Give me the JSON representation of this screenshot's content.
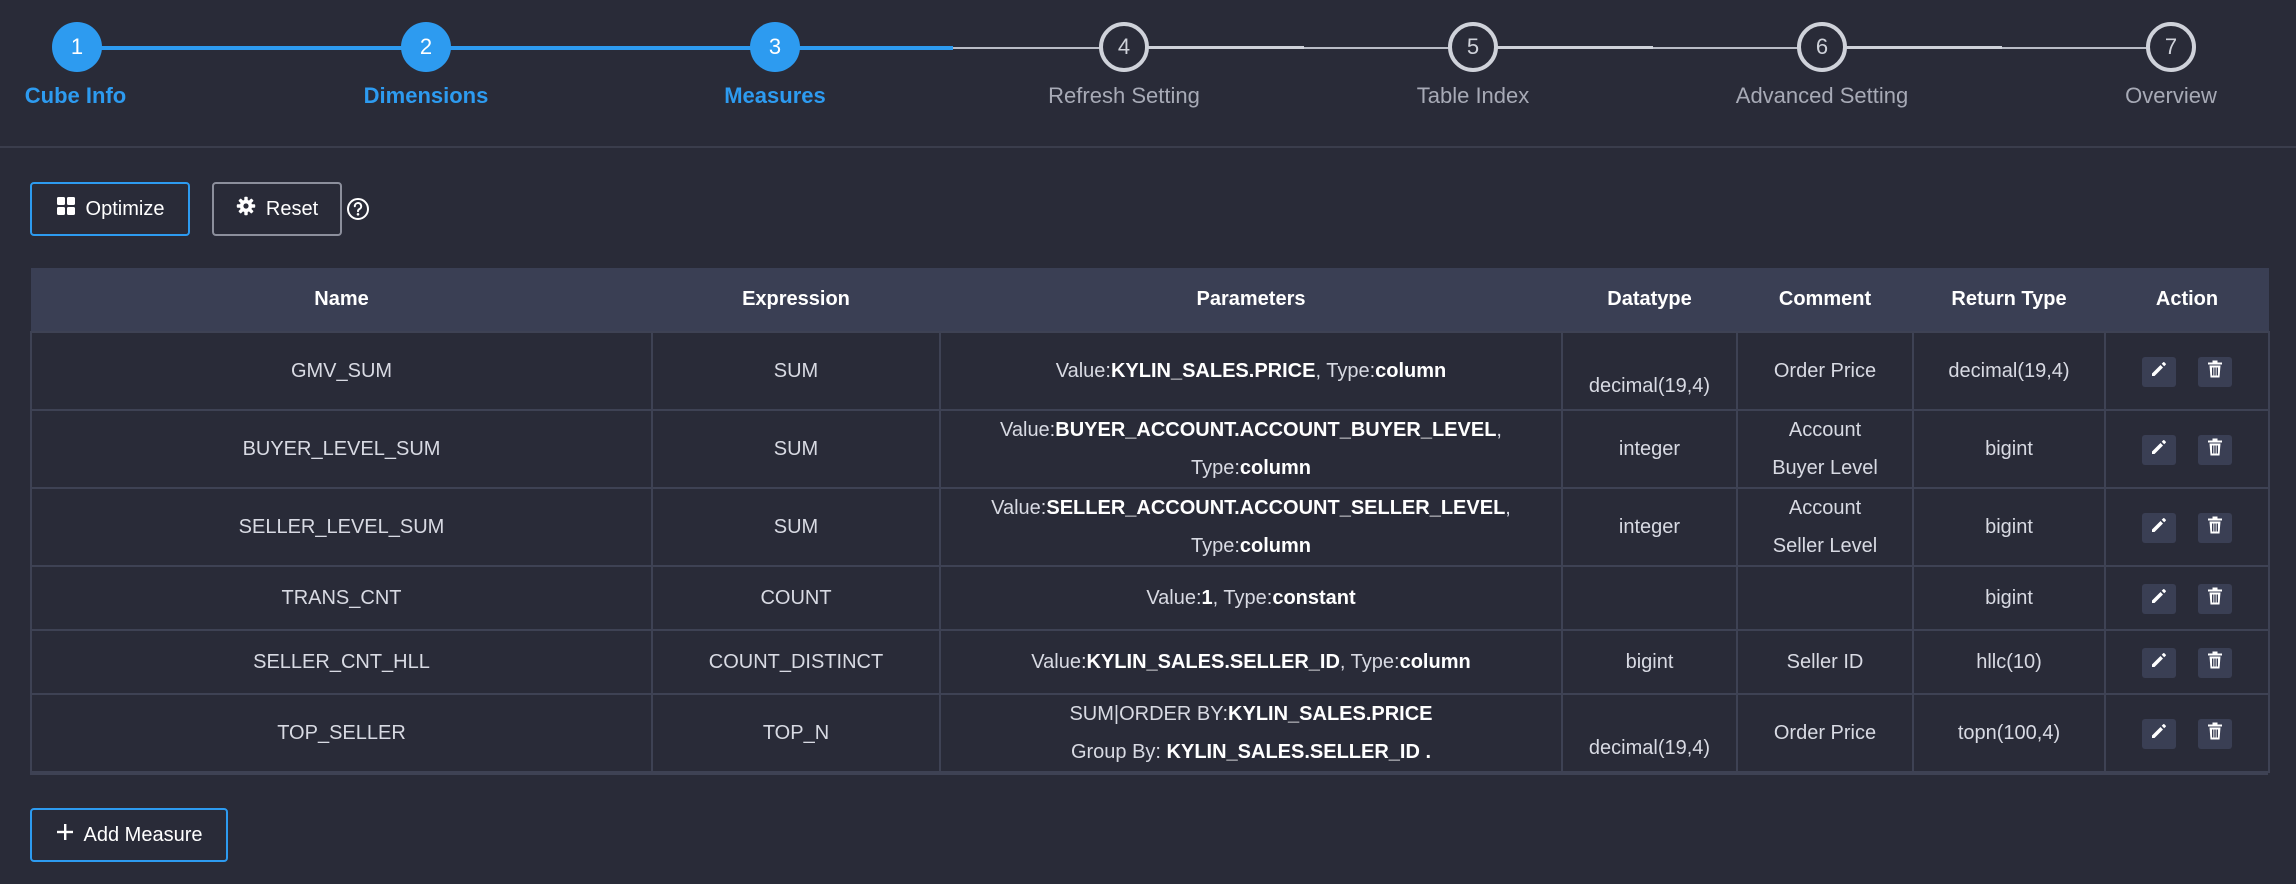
{
  "stepper": {
    "steps": [
      {
        "number": "1",
        "label": "Cube Info",
        "state": "done"
      },
      {
        "number": "2",
        "label": "Dimensions",
        "state": "done"
      },
      {
        "number": "3",
        "label": "Measures",
        "state": "done"
      },
      {
        "number": "4",
        "label": "Refresh Setting",
        "state": "todo"
      },
      {
        "number": "5",
        "label": "Table Index",
        "state": "todo"
      },
      {
        "number": "6",
        "label": "Advanced Setting",
        "state": "todo"
      },
      {
        "number": "7",
        "label": "Overview",
        "state": "todo"
      }
    ]
  },
  "toolbar": {
    "optimize_label": "Optimize",
    "reset_label": "Reset",
    "help_icon": "question-circle-icon"
  },
  "table": {
    "headers": [
      "Name",
      "Expression",
      "Parameters",
      "Datatype",
      "Comment",
      "Return Type",
      "Action"
    ],
    "rows": [
      {
        "name": "GMV_SUM",
        "expression": "SUM",
        "param_value_prefix": "Value:",
        "param_value": "KYLIN_SALES.PRICE",
        "param_type_prefix": ", Type:",
        "param_type": "column",
        "datatype": "decimal(19,4)",
        "comment": "Order Price",
        "return_type": "decimal(19,4)"
      },
      {
        "name": "BUYER_LEVEL_SUM",
        "expression": "SUM",
        "param_value_prefix": "Value:",
        "param_value": "BUYER_ACCOUNT.ACCOUNT_BUYER_LEVEL",
        "param_type_prefix": "Type:",
        "param_type": "column",
        "datatype": "integer",
        "comment_line1": "Account",
        "comment_line2": "Buyer Level",
        "return_type": "bigint"
      },
      {
        "name": "SELLER_LEVEL_SUM",
        "expression": "SUM",
        "param_value_prefix": "Value:",
        "param_value": "SELLER_ACCOUNT.ACCOUNT_SELLER_LEVEL",
        "param_type_prefix": "Type:",
        "param_type": "column",
        "datatype": "integer",
        "comment_line1": "Account",
        "comment_line2": "Seller Level",
        "return_type": "bigint"
      },
      {
        "name": "TRANS_CNT",
        "expression": "COUNT",
        "param_value_prefix": "Value:",
        "param_value": "1",
        "param_type_prefix": ", Type:",
        "param_type": "constant",
        "datatype": "",
        "comment": "",
        "return_type": "bigint"
      },
      {
        "name": "SELLER_CNT_HLL",
        "expression": "COUNT_DISTINCT",
        "param_value_prefix": "Value:",
        "param_value": "KYLIN_SALES.SELLER_ID",
        "param_type_prefix": ", Type:",
        "param_type": "column",
        "datatype": "bigint",
        "comment": "Seller ID",
        "return_type": "hllc(10)"
      },
      {
        "name": "TOP_SELLER",
        "expression": "TOP_N",
        "param_line1_prefix": "SUM|ORDER BY:",
        "param_line1_value": "KYLIN_SALES.PRICE",
        "param_line2_prefix": "Group By: ",
        "param_line2_value": "KYLIN_SALES.SELLER_ID .",
        "datatype": "decimal(19,4)",
        "comment": "Order Price",
        "return_type": "topn(100,4)"
      }
    ],
    "action_icons": [
      "pencil-icon",
      "trash-icon"
    ]
  },
  "footer": {
    "add_measure_label": "Add Measure"
  },
  "colors": {
    "background": "#292b38",
    "accent": "#2d9bf0",
    "header_bg": "#3a3f54",
    "inactive": "#cfd2da"
  }
}
